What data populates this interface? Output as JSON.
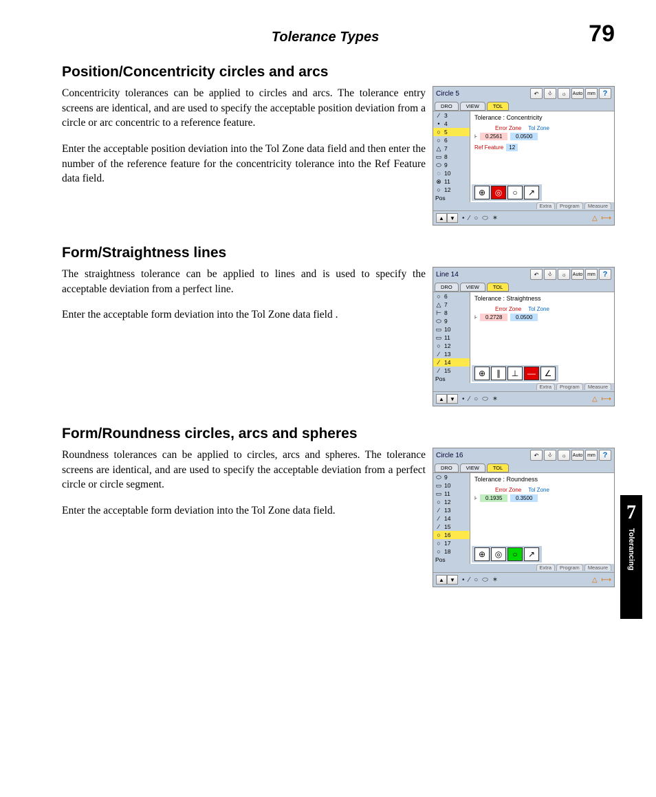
{
  "page": {
    "header_title": "Tolerance Types",
    "page_number": "79",
    "chapter_num": "7",
    "chapter_name": "Tolerancing"
  },
  "sections": {
    "s1": {
      "heading": "Position/Concentricity circles and arcs",
      "p1": "Concentricity tolerances can be applied to circles and arcs.  The tolerance entry screens are identical, and are used to specify the acceptable position deviation from a circle or arc concentric to a reference feature.",
      "p2": "Enter the acceptable position deviation into the Tol Zone data field and then enter the number of the reference feature for the concentricity tolerance into the Ref Feature data field."
    },
    "s2": {
      "heading": "Form/Straightness lines",
      "p1": "The straightness tolerance can be applied to lines and is used to specify the acceptable deviation from a perfect line.",
      "p2": "Enter the acceptable form deviation into the Tol Zone data field ."
    },
    "s3": {
      "heading": "Form/Roundness circles, arcs and spheres",
      "p1": "Roundness tolerances can be applied to circles, arcs and spheres.  The tolerance screens are identical, and are used to specify the acceptable deviation from a perfect circle or circle segment.",
      "p2": "Enter the acceptable form deviation into the Tol Zone data field."
    }
  },
  "ui_common": {
    "tabs": {
      "dro": "DRO",
      "view": "VIEW",
      "tol": "TOL"
    },
    "toolbar": {
      "auto": "Auto",
      "mm": "mm",
      "help": "?"
    },
    "pos_label": "Pos",
    "zone_err": "Error Zone",
    "zone_tol": "Tol Zone",
    "bottom_tabs": {
      "extra": "Extra",
      "program": "Program",
      "measure": "Measure"
    }
  },
  "shots": {
    "a": {
      "title": "Circle 5",
      "tol_label": "Tolerance : Concentricity",
      "err_val": "0.2561",
      "tol_val": "0.0500",
      "ref_label": "Ref Feature",
      "ref_val": "12",
      "list": [
        {
          "ico": "∕",
          "n": "3"
        },
        {
          "ico": "•",
          "n": "4"
        },
        {
          "ico": "○",
          "n": "5",
          "hl": true
        },
        {
          "ico": "○",
          "n": "6"
        },
        {
          "ico": "△",
          "n": "7"
        },
        {
          "ico": "▭",
          "n": "8"
        },
        {
          "ico": "⬭",
          "n": "9"
        },
        {
          "ico": "◌",
          "n": "10"
        },
        {
          "ico": "⊗",
          "n": "11"
        },
        {
          "ico": "○",
          "n": "12"
        }
      ],
      "symbols": [
        {
          "g": "⊕"
        },
        {
          "g": "◎",
          "cls": "sel-red"
        },
        {
          "g": "○"
        },
        {
          "g": "↗"
        }
      ]
    },
    "b": {
      "title": "Line 14",
      "tol_label": "Tolerance : Straightness",
      "err_val": "0.2728",
      "tol_val": "0.0500",
      "list": [
        {
          "ico": "○",
          "n": "6"
        },
        {
          "ico": "△",
          "n": "7"
        },
        {
          "ico": "⊢",
          "n": "8"
        },
        {
          "ico": "⬭",
          "n": "9"
        },
        {
          "ico": "▭",
          "n": "10"
        },
        {
          "ico": "▭",
          "n": "11"
        },
        {
          "ico": "○",
          "n": "12"
        },
        {
          "ico": "∕",
          "n": "13"
        },
        {
          "ico": "∕",
          "n": "14",
          "hl": true
        },
        {
          "ico": "∕",
          "n": "15"
        }
      ],
      "symbols": [
        {
          "g": "⊕"
        },
        {
          "g": "∥"
        },
        {
          "g": "⊥"
        },
        {
          "g": "—",
          "cls": "sel-red"
        },
        {
          "g": "∠"
        }
      ]
    },
    "c": {
      "title": "Circle 16",
      "tol_label": "Tolerance : Roundness",
      "err_val": "0.1935",
      "tol_val": "0.3500",
      "list": [
        {
          "ico": "⬭",
          "n": "9"
        },
        {
          "ico": "▭",
          "n": "10"
        },
        {
          "ico": "▭",
          "n": "11"
        },
        {
          "ico": "○",
          "n": "12"
        },
        {
          "ico": "∕",
          "n": "13"
        },
        {
          "ico": "∕",
          "n": "14"
        },
        {
          "ico": "∕",
          "n": "15"
        },
        {
          "ico": "○",
          "n": "16",
          "hl": true
        },
        {
          "ico": "○",
          "n": "17"
        },
        {
          "ico": "○",
          "n": "18"
        }
      ],
      "symbols": [
        {
          "g": "⊕"
        },
        {
          "g": "◎"
        },
        {
          "g": "○",
          "cls": "sel-green"
        },
        {
          "g": "↗"
        }
      ]
    }
  }
}
